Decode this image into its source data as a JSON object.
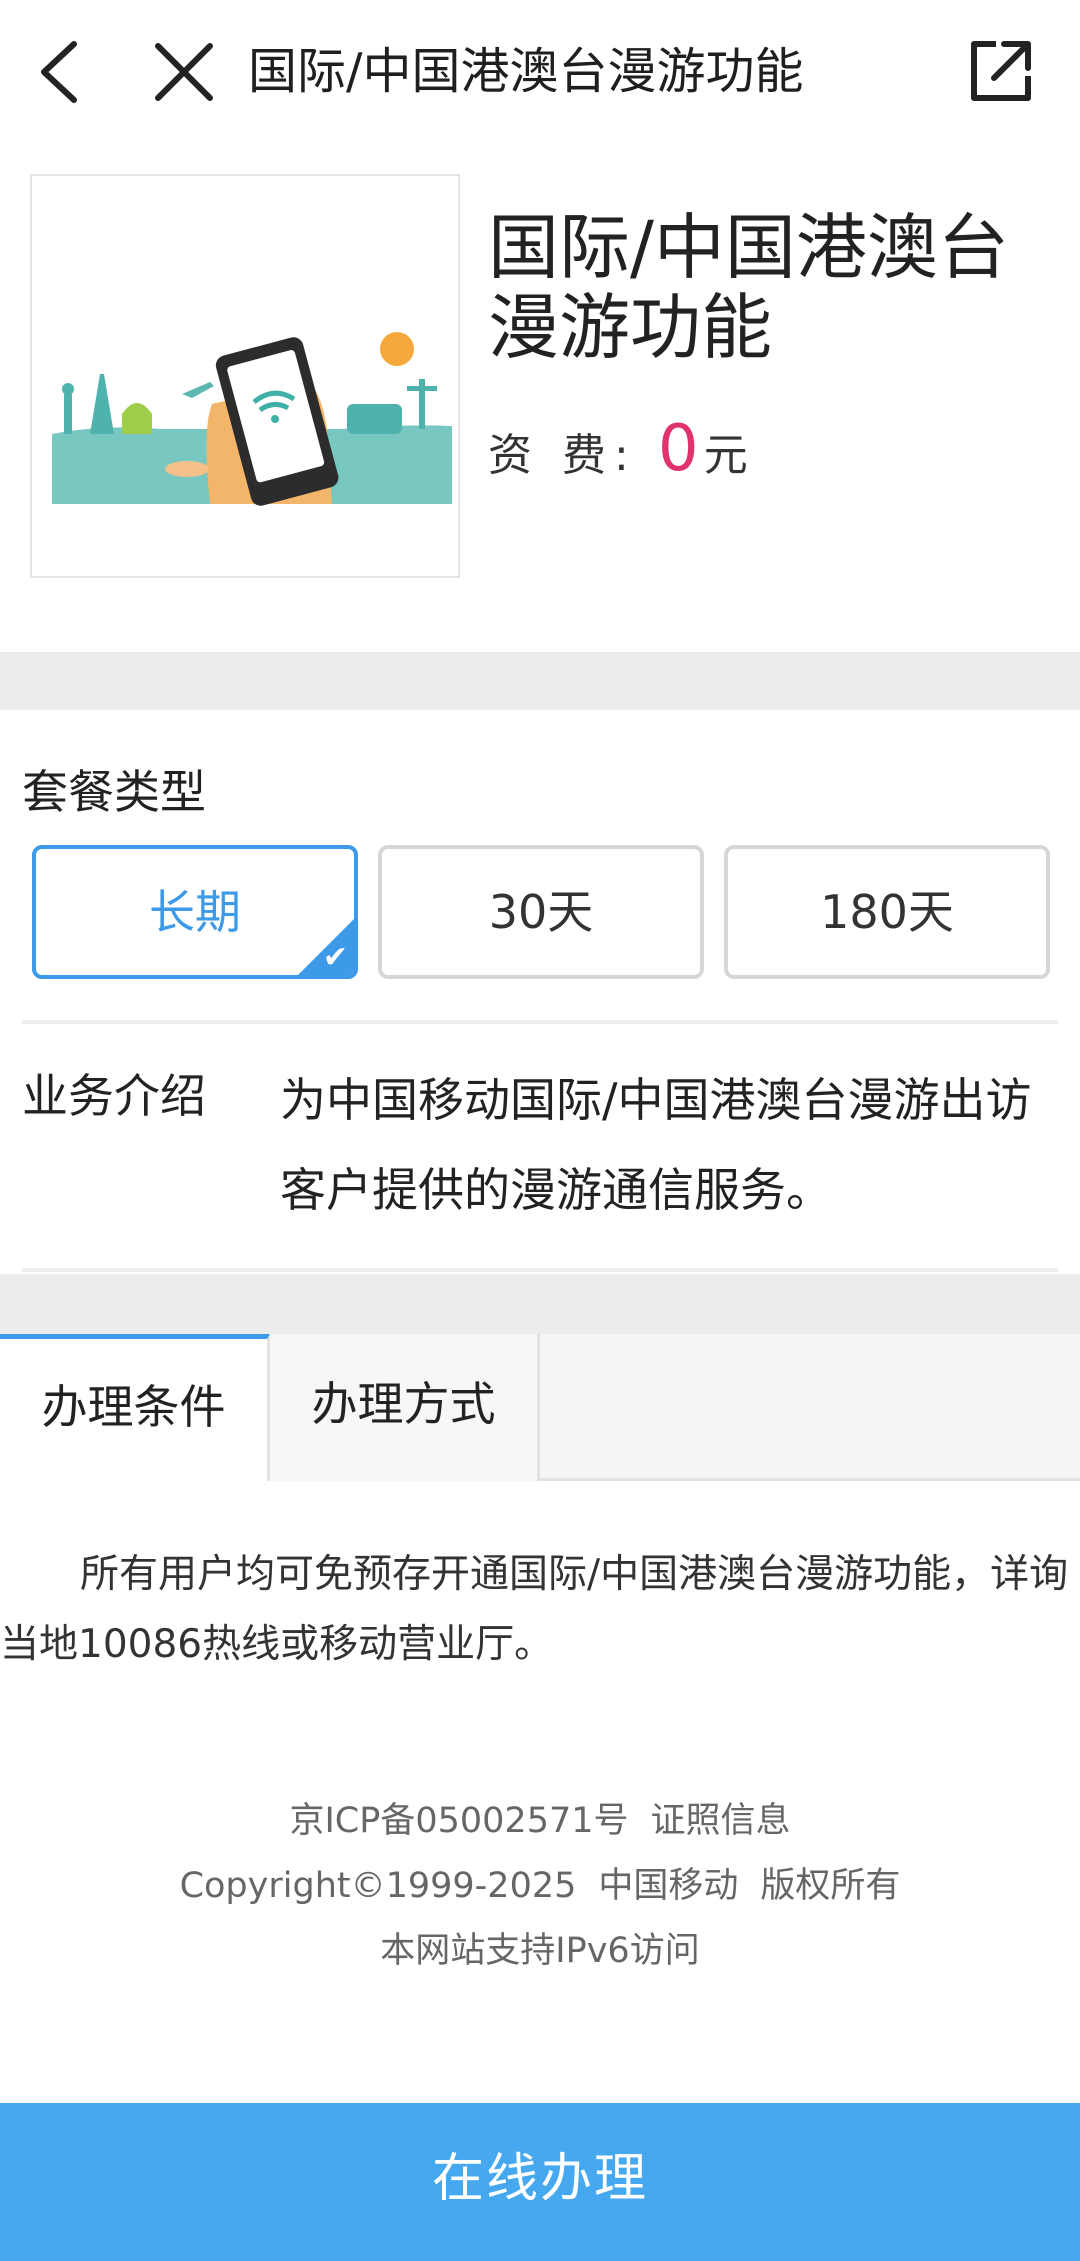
{
  "nav": {
    "title": "国际/中国港澳台漫游功能",
    "back_icon": "back-arrow-icon",
    "close_icon": "close-icon",
    "share_icon": "share-icon"
  },
  "product": {
    "title": "国际/中国港澳台漫游功能",
    "price_label": "资 费:",
    "price_value": "0",
    "price_unit": "元",
    "image_icon": "roaming-illustration"
  },
  "package": {
    "label": "套餐类型",
    "options": [
      "长期",
      "30天",
      "180天"
    ],
    "selected": "长期"
  },
  "intro": {
    "label": "业务介绍",
    "text": "为中国移动国际/中国港澳台漫游出访客户提供的漫游通信服务。"
  },
  "tabs": {
    "items": [
      "办理条件",
      "办理方式"
    ],
    "active": "办理条件"
  },
  "conditions": {
    "text": "所有用户均可免预存开通国际/中国港澳台漫游功能，详询当地10086热线或移动营业厅。"
  },
  "footer": {
    "icp": "京ICP备05002571号",
    "license": "证照信息",
    "copyright": "Copyright©1999-2025",
    "company": "中国移动",
    "rights": "版权所有",
    "ipv6": "本网站支持IPv6访问"
  },
  "action": {
    "label": "在线办理"
  },
  "colors": {
    "accent": "#3d9ae8",
    "price": "#e0336e",
    "button": "#46a9f0",
    "band": "#ececec"
  }
}
